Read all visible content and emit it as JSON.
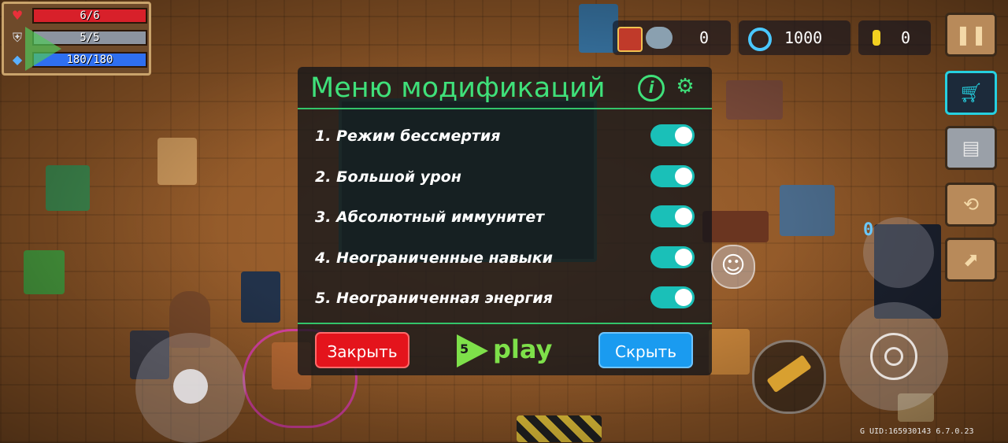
{
  "stats": {
    "hp": {
      "text": "6/6",
      "fraction": 1.0,
      "color": "#d8202a",
      "icon": "heart-icon"
    },
    "armor": {
      "text": "5/5",
      "fraction": 1.0,
      "color": "#8c94a0",
      "icon": "shield-icon"
    },
    "energy": {
      "text": "180/180",
      "fraction": 1.0,
      "color": "#2f6ff0",
      "icon": "energy-gem-icon"
    }
  },
  "currency": {
    "materials": {
      "value": "0",
      "icon": "materials-icon"
    },
    "gems": {
      "value": "1000",
      "icon": "gem-icon"
    },
    "coins": {
      "value": "0",
      "icon": "coin-icon"
    }
  },
  "side_buttons": [
    "pause-icon",
    "shop-cart-icon",
    "profile-card-icon",
    "swap-icon",
    "upgrade-icon"
  ],
  "mod_menu": {
    "title": "Меню модификаций",
    "options": [
      {
        "label": "1. Режим бессмертия",
        "enabled": true
      },
      {
        "label": "2. Большой урон",
        "enabled": true
      },
      {
        "label": "3. Абсолютный иммунитет",
        "enabled": true
      },
      {
        "label": "4. Неограниченные навыки",
        "enabled": true
      },
      {
        "label": "5. Неограниченная энергия",
        "enabled": true
      }
    ],
    "close_label": "Закрыть",
    "brand_badge": "5",
    "brand_label": "play",
    "hide_label": "Скрыть",
    "accent": "#3fe07a"
  },
  "skill_counter": "0",
  "footer": {
    "uid": "G UID:165930143 6.7.0.23"
  }
}
